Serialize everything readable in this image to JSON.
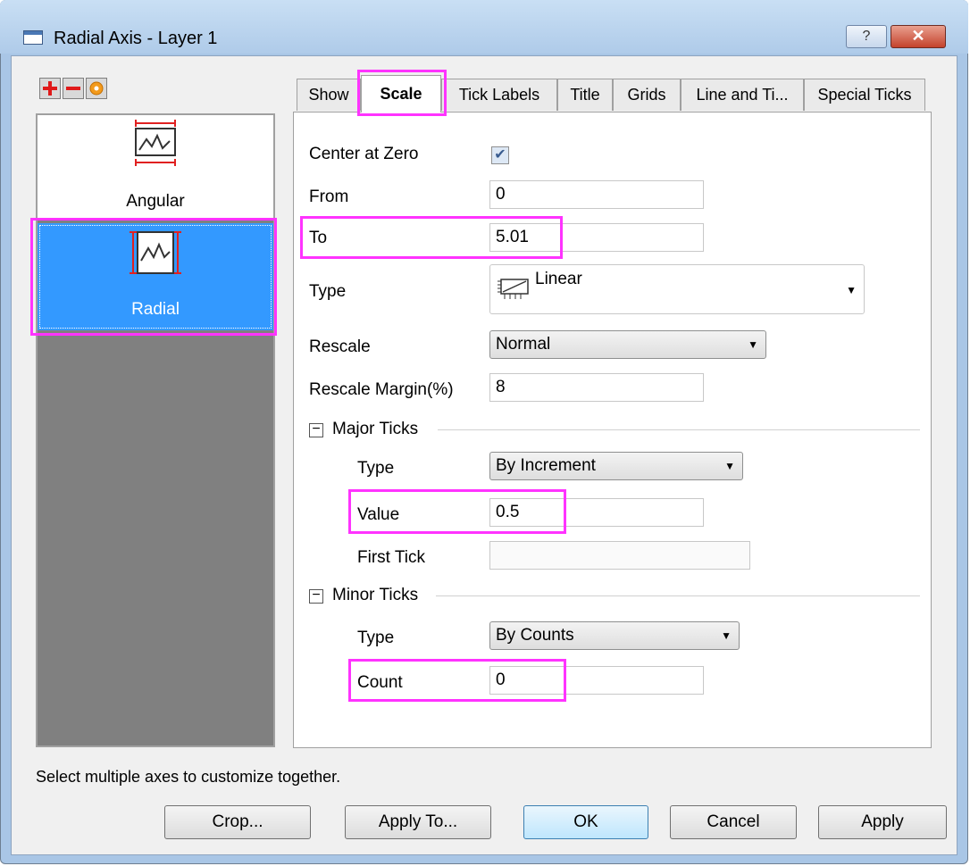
{
  "window": {
    "title": "Radial Axis - Layer 1",
    "help_label": "?",
    "close_label": "✕"
  },
  "toolbar": {
    "add_icon": "plus-icon",
    "remove_icon": "minus-icon",
    "reset_icon": "circle-icon"
  },
  "axes": [
    {
      "label": "Angular",
      "icon": "angular-axis-icon",
      "selected": false
    },
    {
      "label": "Radial",
      "icon": "radial-axis-icon",
      "selected": true
    }
  ],
  "tabs": [
    {
      "label": "Show"
    },
    {
      "label": "Scale",
      "active": true
    },
    {
      "label": "Tick Labels"
    },
    {
      "label": "Title"
    },
    {
      "label": "Grids"
    },
    {
      "label": "Line and Ti..."
    },
    {
      "label": "Special Ticks"
    }
  ],
  "scale": {
    "center_label": "Center at Zero",
    "center_checked": true,
    "from_label": "From",
    "from_value": "0",
    "to_label": "To",
    "to_value": "5.01",
    "type_label": "Type",
    "type_value": "Linear",
    "rescale_label": "Rescale",
    "rescale_value": "Normal",
    "margin_label": "Rescale Margin(%)",
    "margin_value": "8"
  },
  "major": {
    "heading": "Major Ticks",
    "toggle": "−",
    "type_label": "Type",
    "type_value": "By Increment",
    "value_label": "Value",
    "value_value": "0.5",
    "first_label": "First Tick",
    "first_value": ""
  },
  "minor": {
    "heading": "Minor Ticks",
    "toggle": "−",
    "type_label": "Type",
    "type_value": "By Counts",
    "count_label": "Count",
    "count_value": "0"
  },
  "status": "Select multiple axes to customize together.",
  "buttons": {
    "crop": "Crop...",
    "apply_to": "Apply To...",
    "ok": "OK",
    "cancel": "Cancel",
    "apply": "Apply"
  },
  "colors": {
    "highlight": "#ff33ff",
    "selection": "#3399ff",
    "list_bg": "#808080"
  }
}
